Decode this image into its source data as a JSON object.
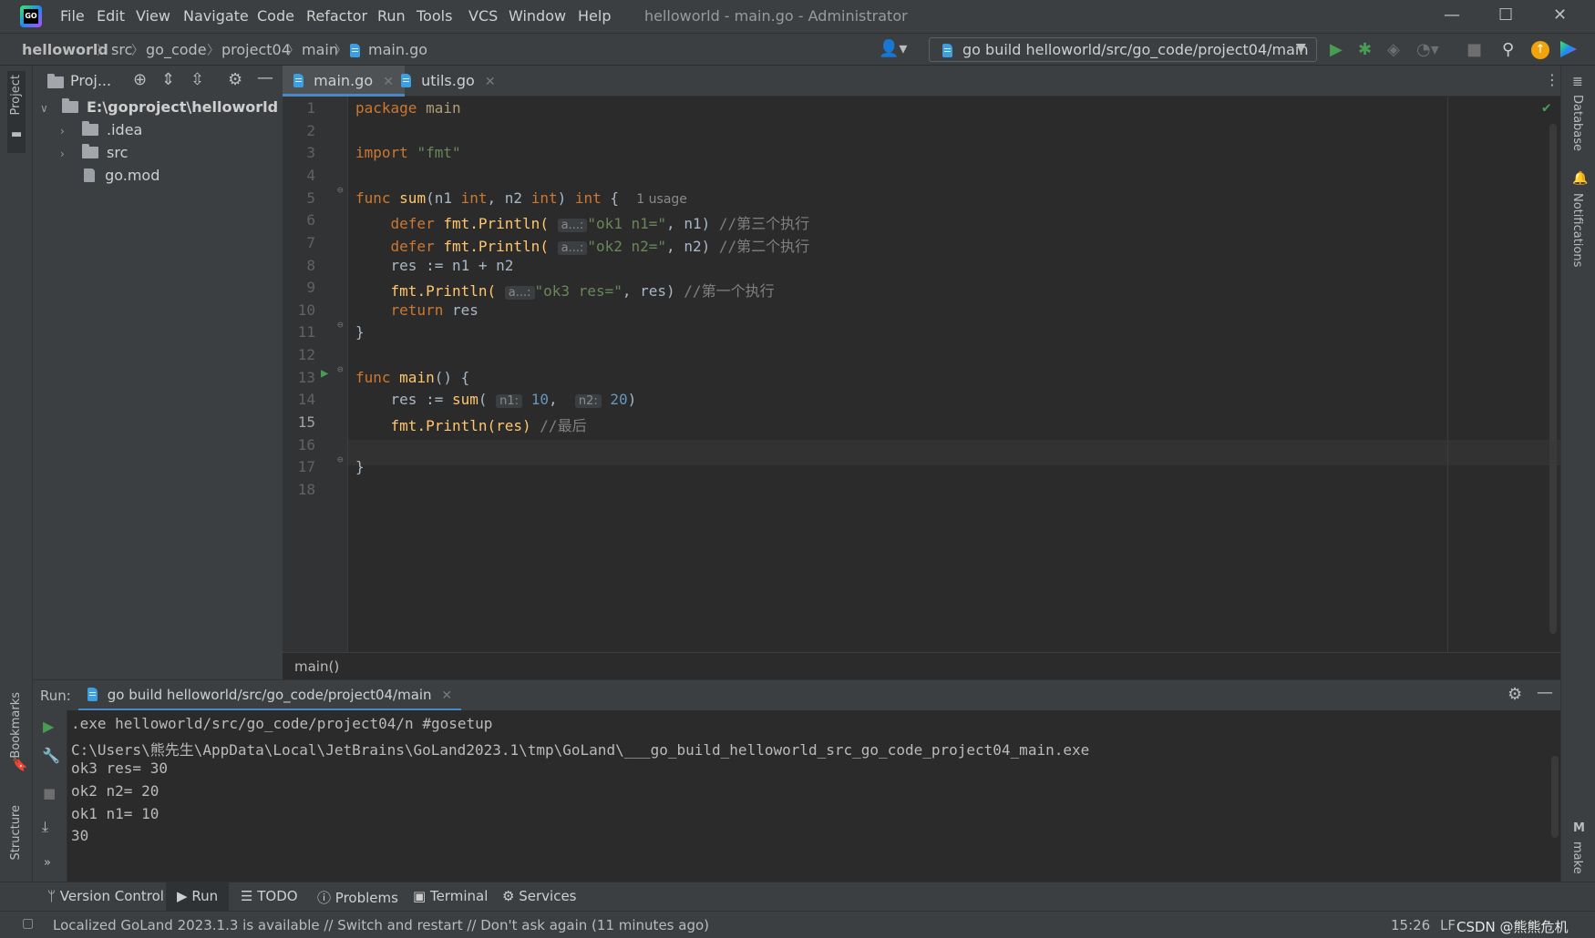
{
  "app": {
    "logo_text": "GO",
    "window_title": "helloworld - main.go - Administrator"
  },
  "menu": [
    "File",
    "Edit",
    "View",
    "Navigate",
    "Code",
    "Refactor",
    "Run",
    "Tools",
    "VCS",
    "Window",
    "Help"
  ],
  "breadcrumbs": [
    "helloworld",
    "src",
    "go_code",
    "project04",
    "main",
    "main.go"
  ],
  "run_config": {
    "label": "go build helloworld/src/go_code/project04/main"
  },
  "left_stripe": {
    "project_label": "Project",
    "bookmarks_label": "Bookmarks",
    "structure_label": "Structure"
  },
  "right_stripe": {
    "database_label": "Database",
    "notifications_label": "Notifications",
    "make_label": "make",
    "make_icon": "M"
  },
  "project_panel": {
    "title": "Proj...",
    "tree": {
      "root": "E:\\goproject\\helloworld",
      "items": [
        ".idea",
        "src",
        "go.mod"
      ]
    }
  },
  "editor": {
    "tabs": [
      "main.go",
      "utils.go"
    ],
    "line_numbers": [
      "1",
      "2",
      "3",
      "4",
      "5",
      "6",
      "7",
      "8",
      "9",
      "10",
      "11",
      "12",
      "13",
      "14",
      "15",
      "16",
      "17",
      "18"
    ],
    "current_line": "15",
    "tokens": {
      "package": "package",
      "main": "main",
      "import": "import",
      "fmt_str": "\"fmt\"",
      "func": "func",
      "sum": "sum",
      "sum_params_1": "(n1 ",
      "int": "int",
      "sum_params_2": ", n2 ",
      "sum_params_3": ") ",
      "brace_open": " {",
      "usage": "1 usage",
      "defer": "defer",
      "fmt": "fmt",
      "println": ".Println(",
      "hint_a": "a...:",
      "ok1": "\"ok1 n1=\"",
      "l6_rest": ", n1) ",
      "c6": "//第三个执行",
      "ok2": "\"ok2 n2=\"",
      "l7_rest": ", n2) ",
      "c7": "//第二个执行",
      "l8": "res := n1 + n2",
      "ok3": "\"ok3 res=\"",
      "l9_rest": ", res) ",
      "c9": "//第一个执行",
      "return": "return",
      "res": " res",
      "brace_close": "}",
      "main_fn": "main",
      "main_params": "()",
      "l14_a": "res := ",
      "l14_sum": "sum",
      "l14_paren": "(",
      "hint_n1": "n1:",
      "n10": "10",
      "comma": ", ",
      "hint_n2": "n2:",
      "n20": "20",
      "close_paren": ")",
      "l15_rest": ".Println(res) ",
      "c15": "//最后"
    },
    "breadcrumb": "main()"
  },
  "run_panel": {
    "label": "Run:",
    "tab": "go build helloworld/src/go_code/project04/main",
    "output": [
      ".exe helloworld/src/go_code/project04/n #gosetup",
      "C:\\Users\\熊先生\\AppData\\Local\\JetBrains\\GoLand2023.1\\tmp\\GoLand\\___go_build_helloworld_src_go_code_project04_main.exe",
      "ok3 res= 30",
      "ok2 n2= 20",
      "ok1 n1= 10",
      "30"
    ]
  },
  "tool_tabs": [
    "Version Control",
    "Run",
    "TODO",
    "Problems",
    "Terminal",
    "Services"
  ],
  "status_bar": {
    "message": "Localized GoLand 2023.1.3 is available // Switch and restart // Don't ask again (11 minutes ago)",
    "position": "15:26",
    "line_ending": "LF",
    "watermark": "CSDN @熊熊危机"
  },
  "colors": {
    "keyword": "#cc7832",
    "function": "#ffc66d",
    "string": "#6a8759",
    "number": "#6897bb",
    "comment": "#808080",
    "run_green": "#499c54",
    "accent": "#4a88c7"
  }
}
